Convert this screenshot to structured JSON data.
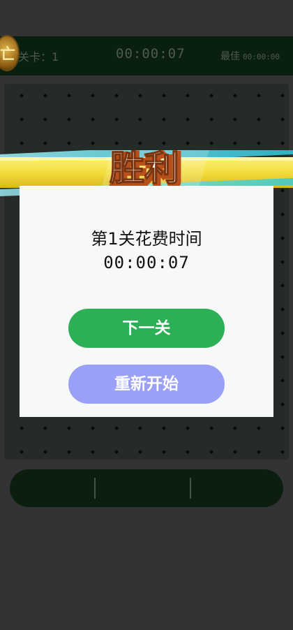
{
  "hud": {
    "level_label": "关卡：1",
    "timer": "00:00:07",
    "best_label": "最佳",
    "best_time": "00:00:00"
  },
  "victory": {
    "banner_title": "胜利",
    "message_line1": "第1关花费时间",
    "message_line2": "00:00:07",
    "next_button": "下一关",
    "restart_button": "重新开始"
  },
  "colors": {
    "accent_green": "#2bb055",
    "restart_purple": "#9aa0f6",
    "banner_yellow": "#f5e04a",
    "banner_cyan": "#3fd8e6"
  }
}
